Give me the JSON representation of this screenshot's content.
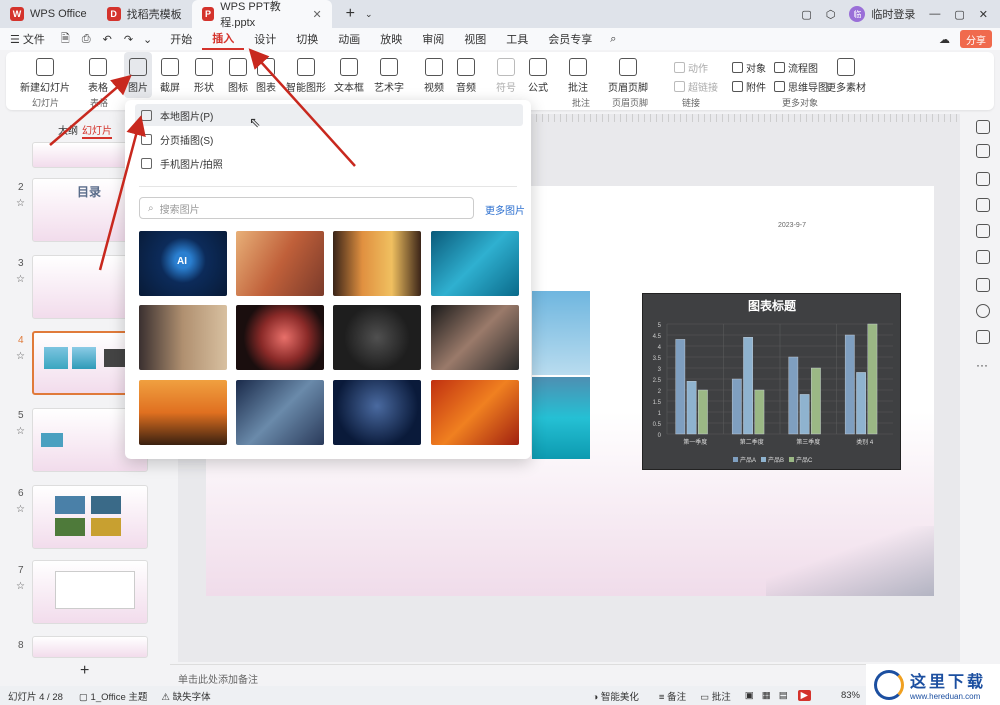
{
  "tabs": [
    {
      "label": "WPS Office",
      "logo": "W",
      "color": "#d4332c"
    },
    {
      "label": "找稻壳模板",
      "logo": "D",
      "color": "#d4332c"
    },
    {
      "label": "WPS PPT教程.pptx",
      "logo": "P",
      "color": "#d4332c"
    }
  ],
  "titlebar": {
    "login": "临时登录",
    "avatar": "临"
  },
  "menu": {
    "file": "文件",
    "items": [
      "开始",
      "插入",
      "设计",
      "切换",
      "动画",
      "放映",
      "审阅",
      "视图",
      "工具",
      "会员专享"
    ],
    "active": "插入",
    "share": "分享"
  },
  "ribbon": {
    "new_slide": "新建幻灯片",
    "table": "表格",
    "picture": "图片",
    "screenshot": "截屏",
    "shape": "形状",
    "icon": "图标",
    "chart": "图表",
    "smart": "智能图形",
    "textbox": "文本框",
    "arttext": "艺术字",
    "video": "视频",
    "audio": "音频",
    "symbol": "符号",
    "formula": "公式",
    "comment": "批注",
    "header_footer": "页眉页脚",
    "action": "动作",
    "hyperlink": "超链接",
    "object": "对象",
    "flowchart": "流程图",
    "attachment": "附件",
    "mindmap": "思维导图",
    "more_material": "更多素材",
    "groups": [
      "幻灯片",
      "表格",
      "",
      "批注",
      "页眉页脚",
      "链接",
      "更多对象"
    ]
  },
  "sidebar": {
    "tab_outline": "大纲",
    "tab_slides": "幻灯片",
    "slide_numbers": [
      "2",
      "3",
      "4",
      "5",
      "6",
      "7",
      "8"
    ],
    "thumb2_title": "目录"
  },
  "dropdown": {
    "items": [
      "本地图片(P)",
      "分页插图(S)",
      "手机图片/拍照"
    ],
    "search_placeholder": "搜索图片",
    "more_pictures": "更多图片",
    "photo_names": [
      "ai-chip-photo",
      "dna-photo",
      "welding-sparks-photo",
      "bacteria-photo",
      "cat-photo",
      "flamingo-photo",
      "businessman-photo",
      "fitness-woman-photo",
      "surfer-photo",
      "building-photo",
      "high-jump-photo",
      "autumn-leaves-photo"
    ]
  },
  "slide": {
    "date": "2023-9-7"
  },
  "chart_data": {
    "type": "bar",
    "title": "图表标题",
    "categories": [
      "第一季度",
      "第二季度",
      "第三季度",
      "类别 4"
    ],
    "series": [
      {
        "name": "产品A",
        "values": [
          4.3,
          2.5,
          3.5,
          4.5
        ],
        "color": "#7f9fc0"
      },
      {
        "name": "产品B",
        "values": [
          2.4,
          4.4,
          1.8,
          2.8
        ],
        "color": "#8fb3cf"
      },
      {
        "name": "产品C",
        "values": [
          2,
          2,
          3,
          5
        ],
        "color": "#9bb885"
      }
    ],
    "y_ticks": [
      "0",
      "0.5",
      "1",
      "1.5",
      "2",
      "2.5",
      "3",
      "3.5",
      "4",
      "4.5",
      "5"
    ],
    "ylim": [
      0,
      5
    ],
    "legend": "bottom"
  },
  "notes_placeholder": "单击此处添加备注",
  "status": {
    "slide_info": "幻灯片 4 / 28",
    "theme": "1_Office 主题",
    "missing_font": "缺失字体",
    "beautify": "智能美化",
    "notes": "备注",
    "comment": "批注",
    "zoom": "83%"
  },
  "watermark": {
    "text": "这里下载",
    "url": "www.hereduan.com"
  }
}
